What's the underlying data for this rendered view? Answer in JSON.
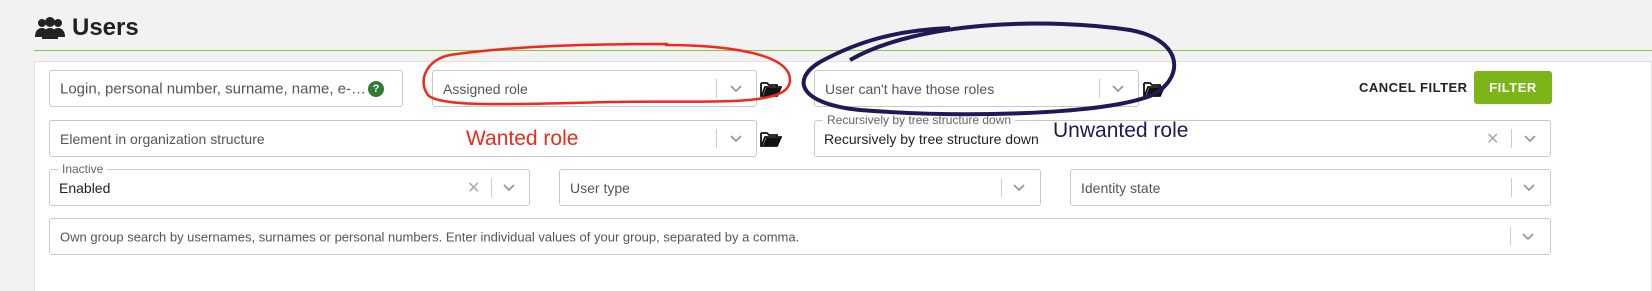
{
  "page": {
    "title": "Users",
    "icon": "users-icon"
  },
  "filters": {
    "search": {
      "placeholder": "Login, personal number, surname, name, e-mail..."
    },
    "assigned_role": {
      "placeholder": "Assigned role"
    },
    "excluded_roles": {
      "placeholder": "User can't have those roles"
    },
    "org_element": {
      "placeholder": "Element in organization structure"
    },
    "recursion": {
      "label": "Recursively by tree structure down",
      "value": "Recursively by tree structure down"
    },
    "inactive": {
      "label": "Inactive",
      "value": "Enabled"
    },
    "user_type": {
      "placeholder": "User type"
    },
    "identity_state": {
      "placeholder": "Identity state"
    },
    "group_search": {
      "placeholder": "Own group search by usernames, surnames or personal numbers. Enter individual values of your group, separated by a comma."
    }
  },
  "actions": {
    "cancel_filter": "CANCEL FILTER",
    "filter": "FILTER"
  },
  "annotations": {
    "wanted": "Wanted role",
    "unwanted": "Unwanted role"
  },
  "colors": {
    "accent": "#7cb518",
    "annotation_red": "#ee2a1c",
    "annotation_navy": "#1f1a55"
  }
}
